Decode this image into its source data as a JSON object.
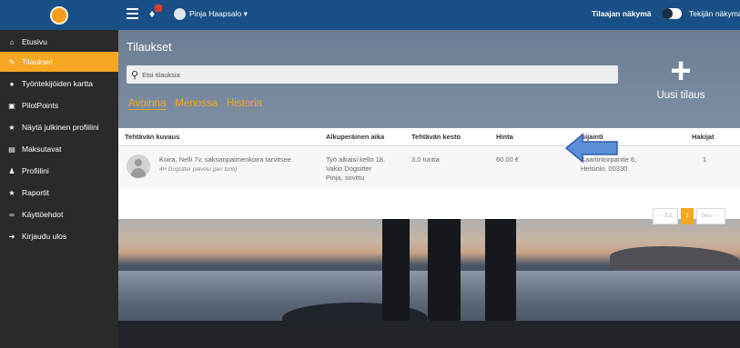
{
  "topbar": {
    "user_name": "Pinja Haapsalo",
    "view_client": "Tilaajan näkymä",
    "view_worker": "Tekijän näkymä"
  },
  "sidebar": {
    "items": [
      {
        "label": "Etusivu",
        "icon": "home-icon"
      },
      {
        "label": "Tilaukset",
        "icon": "edit-icon"
      },
      {
        "label": "Työntekijöiden kartta",
        "icon": "map-pin-icon"
      },
      {
        "label": "PilotPoints",
        "icon": "gift-icon"
      },
      {
        "label": "Näytä julkinen profiilini",
        "icon": "star-icon"
      },
      {
        "label": "Maksutavat",
        "icon": "credit-card-icon"
      },
      {
        "label": "Profiilini",
        "icon": "user-icon"
      },
      {
        "label": "Raportit",
        "icon": "star-icon"
      },
      {
        "label": "Käyttöehdot",
        "icon": "handshake-icon"
      },
      {
        "label": "Kirjaudu ulos",
        "icon": "logout-icon"
      }
    ],
    "active_index": 1
  },
  "main": {
    "title": "Tilaukset",
    "search_placeholder": "Etsi tilauksia",
    "new_order_label": "Uusi tilaus",
    "tabs": [
      "Avoinna",
      "Menossa",
      "Historia"
    ],
    "active_tab": 0
  },
  "table": {
    "headers": [
      "Tehtävän kuvaus",
      "Alkuperäinen aika",
      "Tehtävän kesto",
      "Hinta",
      "Sijainti",
      "Hakijat"
    ],
    "rows": [
      {
        "description": "Koira, Nelli 7v, saksanpaimenkoira tarvitsee",
        "service": "4H Dogsitter palvelu (per tunti)",
        "time_line1": "Työ alkaisi kello 18.",
        "time_line2": "Vakio Dogsitter",
        "time_line3": "Pinja, sovittu",
        "duration": "3.0 tuntia",
        "price": "60.00 €",
        "location_line1": "Kaartintorpantie 6,",
        "location_line2": "Helsinki, 00330",
        "applicants": "1"
      }
    ]
  },
  "pagination": {
    "prev": "← Ed.",
    "current": "1",
    "next": "Seur →"
  },
  "colors": {
    "topbar": "#184f86",
    "accent": "#f5a623",
    "sidebar": "#2a2a2a",
    "arrow": "#5b8fd6"
  }
}
